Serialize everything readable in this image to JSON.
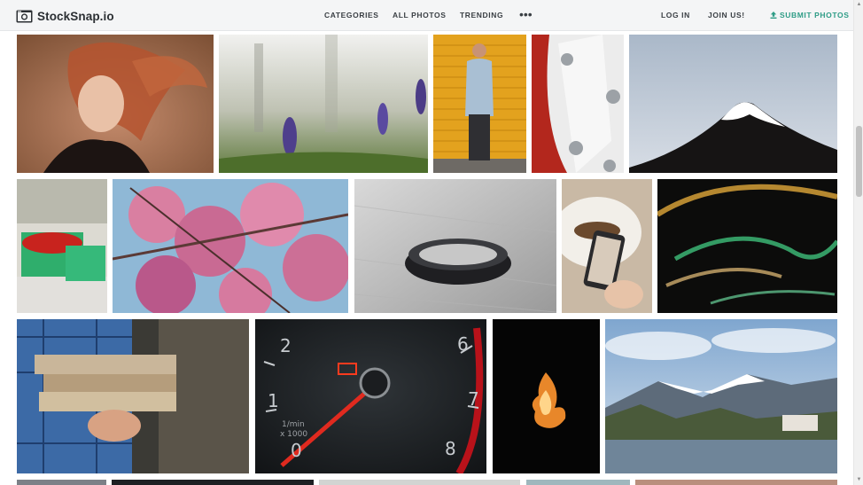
{
  "brand": {
    "name": "StockSnap.io",
    "icon": "camera-icon"
  },
  "nav": {
    "categories": "CATEGORIES",
    "all_photos": "ALL PHOTOS",
    "trending": "TRENDING",
    "more": "•••",
    "log_in": "LOG IN",
    "join_us": "JOIN US!",
    "submit_photos": "SUBMIT PHOTOS"
  },
  "colors": {
    "accent": "#2e9c86",
    "navbar_bg": "#f4f5f6",
    "text_dark": "#2b2f33"
  },
  "gallery": {
    "photos": [
      {
        "name": "photo-woman-red-hair"
      },
      {
        "name": "photo-purple-flowers"
      },
      {
        "name": "photo-man-yellow-wall"
      },
      {
        "name": "photo-white-pipe-bolts"
      },
      {
        "name": "photo-snowy-volcano"
      },
      {
        "name": "photo-strawberry-baskets"
      },
      {
        "name": "photo-cherry-blossoms"
      },
      {
        "name": "photo-black-ring"
      },
      {
        "name": "photo-phone-food"
      },
      {
        "name": "photo-light-trails"
      },
      {
        "name": "photo-firewood"
      },
      {
        "name": "photo-tachometer"
      },
      {
        "name": "photo-fire-dark"
      },
      {
        "name": "photo-lake-castle-mountains"
      }
    ],
    "speedometer": {
      "numbers": [
        "2",
        "1",
        "6",
        "7",
        "8",
        "0"
      ],
      "unit_line1": "1/min",
      "unit_line2": "x 1000"
    }
  }
}
